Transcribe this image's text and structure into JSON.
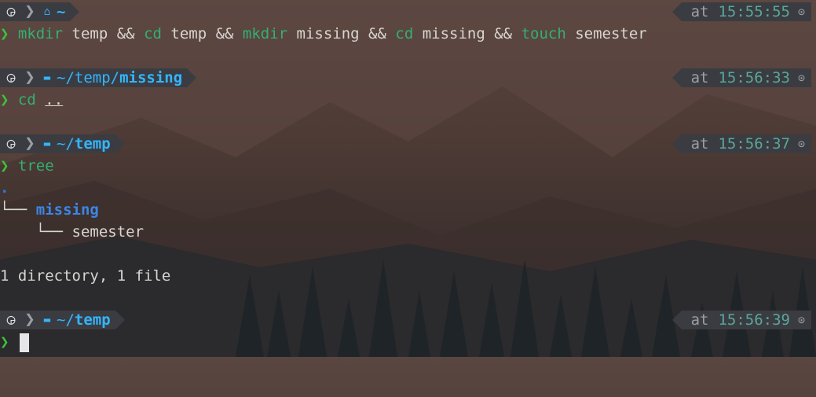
{
  "colors": {
    "prompt_segment_bg": "#3a3c41",
    "path": "#34b5ff",
    "command": "#33b071",
    "chevron": "#3fc23a",
    "time": "#5aa79a",
    "tree_dir": "#3c86e8"
  },
  "icons": {
    "os": "ubuntu-icon",
    "home": "home-icon",
    "folder": "folder-icon",
    "clock": "clock-icon",
    "chevron": "prompt-chevron-icon"
  },
  "prompts": [
    {
      "path_dim": "",
      "path_bold": "~",
      "time": "15:55:55",
      "at": "at"
    },
    {
      "path_dim": "~/temp/",
      "path_bold": "missing",
      "time": "15:56:33",
      "at": "at"
    },
    {
      "path_dim": "~/",
      "path_bold": "temp",
      "time": "15:56:37",
      "at": "at"
    },
    {
      "path_dim": "~/",
      "path_bold": "temp",
      "time": "15:56:39",
      "at": "at"
    }
  ],
  "glyphs": {
    "os": "◶",
    "sep": "❯",
    "home": "⌂",
    "folder": "▬",
    "clock": "⊙",
    "chevron": "❯"
  },
  "commands": {
    "c1": {
      "w1": "mkdir",
      "a1": " temp && ",
      "w2": "cd",
      "a2": " temp && ",
      "w3": "mkdir",
      "a3": " missing && ",
      "w4": "cd",
      "a4": " missing && ",
      "w5": "touch",
      "a5": " semester"
    },
    "c2": {
      "w1": "cd",
      "arg": ".."
    },
    "c3": {
      "w1": "tree"
    }
  },
  "tree_output": {
    "root": ".",
    "branch1": "└── ",
    "dir": "missing",
    "branch2": "    └── ",
    "file": "semester",
    "summary": "1 directory, 1 file"
  }
}
